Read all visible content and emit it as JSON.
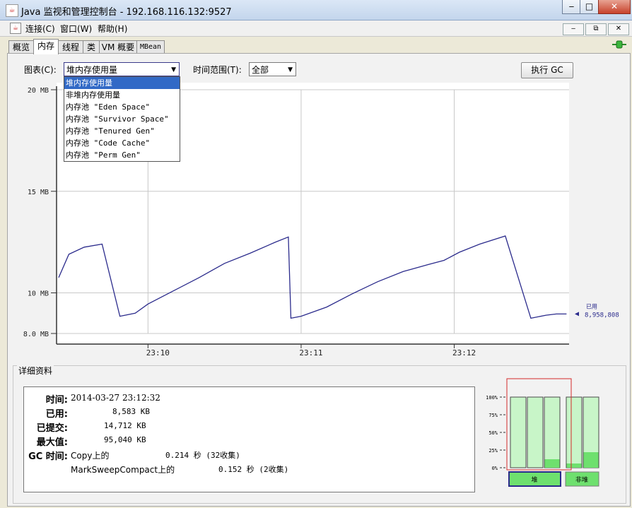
{
  "window": {
    "title": "Java 监视和管理控制台 - 192.168.116.132:9527",
    "icon": "java-cup-icon"
  },
  "window_controls": {
    "minimize": "‒",
    "maximize": "□",
    "close": "✕"
  },
  "menu": {
    "items": [
      "连接(C)",
      "窗口(W)",
      "帮助(H)"
    ],
    "mdi": {
      "minimize": "‒",
      "restore": "⧉",
      "close": "✕"
    }
  },
  "tabs": [
    {
      "label": "概览"
    },
    {
      "label": "内存"
    },
    {
      "label": "线程"
    },
    {
      "label": "类"
    },
    {
      "label": "VM 概要"
    },
    {
      "label": "MBean"
    }
  ],
  "active_tab": "内存",
  "controls": {
    "chart_label": "图表(C):",
    "chart_value": "堆内存使用量",
    "time_label": "时间范围(T):",
    "time_value": "全部",
    "gc_button": "执行 GC"
  },
  "dropdown_options": [
    "堆内存使用量",
    "非堆内存使用量",
    "内存池 \"Eden Space\"",
    "内存池 \"Survivor Space\"",
    "内存池 \"Tenured Gen\"",
    "内存池 \"Code Cache\"",
    "内存池 \"Perm Gen\""
  ],
  "chart_data": {
    "type": "line",
    "title": "",
    "xlabel": "",
    "ylabel": "",
    "y_ticks": [
      "20 MB",
      "15 MB",
      "10 MB",
      "8.0 MB"
    ],
    "x_ticks": [
      "23:10",
      "23:11",
      "23:12"
    ],
    "ylim": [
      8.0,
      20.0
    ],
    "grid": true,
    "series": [
      {
        "name": "已用",
        "color": "#2b2b8c",
        "current_value_label": "8,958,808",
        "x": [
          "23:09:25",
          "23:09:29",
          "23:09:35",
          "23:09:42",
          "23:09:49",
          "23:09:55",
          "23:10:00",
          "23:10:10",
          "23:10:20",
          "23:10:30",
          "23:10:40",
          "23:10:50",
          "23:10:55",
          "23:10:56",
          "23:11:00",
          "23:11:10",
          "23:11:20",
          "23:11:30",
          "23:11:40",
          "23:11:50",
          "23:11:56",
          "23:12:02",
          "23:12:10",
          "23:12:20",
          "23:12:30",
          "23:12:36",
          "23:12:40",
          "23:12:44"
        ],
        "values": [
          10.75,
          11.9,
          12.25,
          12.4,
          8.85,
          9.0,
          9.45,
          10.1,
          10.75,
          11.45,
          11.95,
          12.5,
          12.75,
          8.75,
          8.85,
          9.3,
          9.95,
          10.55,
          11.05,
          11.4,
          11.6,
          12.0,
          12.4,
          12.8,
          8.75,
          8.9,
          8.96,
          8.96
        ]
      }
    ]
  },
  "details": {
    "title": "详细资料",
    "time_label": "时间:",
    "time_value": "2014-03-27 23:12:32",
    "used_label": "已用:",
    "used_value": "8,583 KB",
    "committed_label": "已提交:",
    "committed_value": "14,712 KB",
    "max_label": "最大值:",
    "max_value": "95,040 KB",
    "gc_label": "GC 时间:",
    "gc1_name": "Copy上的",
    "gc1_time": "0.214 秒 (32收集)",
    "gc2_name": "MarkSweepCompact上的",
    "gc2_time": "0.152 秒 (2收集)"
  },
  "pool_bars": {
    "ticks": [
      "100%",
      "75%",
      "50%",
      "25%",
      "0%"
    ],
    "heap_label": "堆",
    "nonheap_label": "非堆",
    "heap_fill": [
      0.0,
      0.0,
      0.12
    ],
    "nonheap_fill": [
      0.06,
      0.22
    ]
  },
  "colors": {
    "line": "#2b2b8c",
    "bar_bg": "#c8f5c8",
    "bar_fill": "#6ee06e",
    "selected": "#3169c6",
    "heap_box": "#d42a2a"
  }
}
